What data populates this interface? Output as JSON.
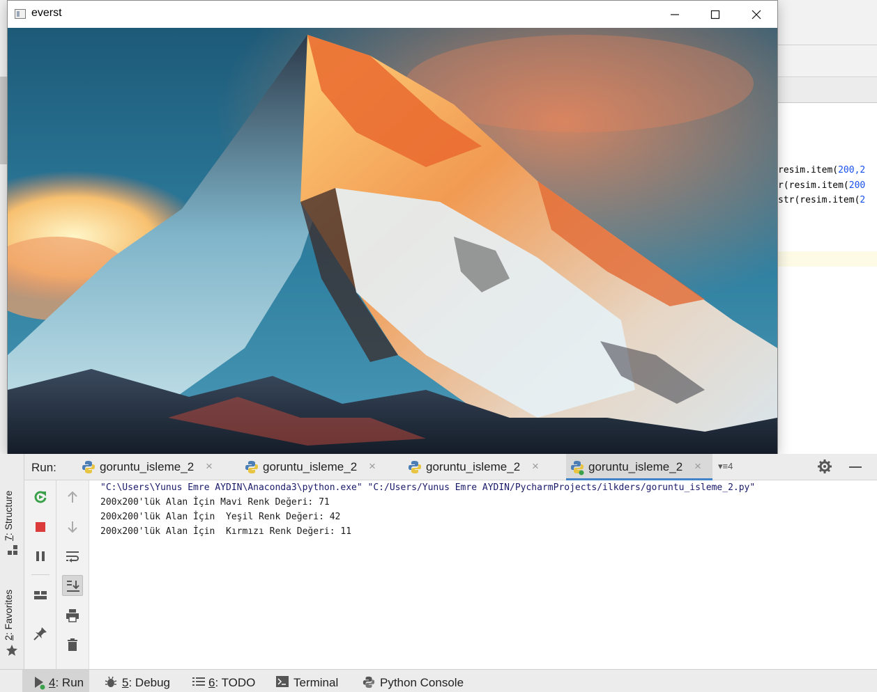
{
  "cv_window": {
    "title": "everst",
    "minimize_glyph": "minimize-icon",
    "maximize_glyph": "maximize-icon",
    "close_glyph": "close-icon"
  },
  "editor": {
    "lines": [
      {
        "prefix": "resim.item(",
        "num": "200,2"
      },
      {
        "prefix": "r(resim.item(",
        "num": "200"
      },
      {
        "prefix": "str(resim.item(",
        "num": "2"
      }
    ]
  },
  "side_tabs": {
    "structure": {
      "num": "7",
      "label": ": Structure"
    },
    "favorites": {
      "num": "2",
      "label": ": Favorites"
    }
  },
  "run_panel": {
    "label": "Run:",
    "tabs": [
      {
        "label": "goruntu_isleme_2",
        "active": false
      },
      {
        "label": "goruntu_isleme_2",
        "active": false
      },
      {
        "label": "goruntu_isleme_2",
        "active": false
      },
      {
        "label": "goruntu_isleme_2",
        "active": true
      }
    ],
    "overflow_count": "4"
  },
  "console": {
    "command": "\"C:\\Users\\Yunus Emre AYDIN\\Anaconda3\\python.exe\" \"C:/Users/Yunus Emre AYDIN/PycharmProjects/ilkders/goruntu_isleme_2.py\"",
    "output": [
      "200x200'lük Alan İçin Mavi Renk Değeri: 71",
      "200x200'lük Alan İçin  Yeşil Renk Değeri: 42",
      "200x200'lük Alan İçin  Kırmızı Renk Değeri: 11"
    ]
  },
  "status_bar": {
    "run": {
      "num": "4",
      "label": ": Run"
    },
    "debug": {
      "num": "5",
      "label": ": Debug"
    },
    "todo": {
      "num": "6",
      "label": ": TODO"
    },
    "terminal": {
      "label": "Terminal"
    },
    "python_console": {
      "label": "Python Console"
    }
  },
  "colors": {
    "accent": "#4083c9",
    "stop_red": "#db3b3b",
    "rerun_green": "#3aa14a"
  }
}
